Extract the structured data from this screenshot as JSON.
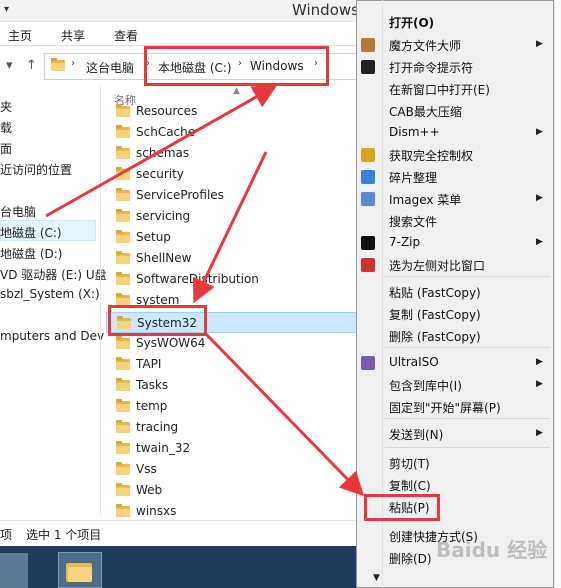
{
  "window": {
    "title": "Windows"
  },
  "ribbon": {
    "tabs": [
      "主页",
      "共享",
      "查看"
    ]
  },
  "address": {
    "crumbs": [
      "这台电脑",
      "本地磁盘 (C:)",
      "Windows"
    ]
  },
  "nav": {
    "items": [
      "夹",
      "载",
      "面",
      "近访问的位置",
      "台电脑",
      "地磁盘 (C:)",
      "地磁盘 (D:)",
      "VD 驱动器 (E:) U盘",
      "sbzl_System (X:)",
      "mputers and Dev"
    ]
  },
  "filelist": {
    "column_header": "名称",
    "folders": [
      "Resources",
      "SchCache",
      "schemas",
      "security",
      "ServiceProfiles",
      "servicing",
      "Setup",
      "ShellNew",
      "SoftwareDistribution",
      "system",
      "System32",
      "SysWOW64",
      "TAPI",
      "Tasks",
      "temp",
      "tracing",
      "twain_32",
      "Vss",
      "Web",
      "winsxs"
    ],
    "selected": "System32"
  },
  "status": {
    "count": "项",
    "selection": "选中 1 个项目"
  },
  "context_menu": {
    "items": [
      {
        "label": "打开(O)",
        "bold": true
      },
      {
        "label": "魔方文件大师",
        "submenu": true,
        "icon": "mofang-icon"
      },
      {
        "label": "打开命令提示符",
        "icon": "cmd-icon"
      },
      {
        "label": "在新窗口中打开(E)"
      },
      {
        "label": "CAB最大压缩"
      },
      {
        "label": "Dism++",
        "submenu": true
      },
      {
        "label": "获取完全控制权",
        "icon": "shield-icon"
      },
      {
        "label": "碎片整理",
        "icon": "defrag-icon"
      },
      {
        "label": "Imagex 菜单",
        "submenu": true,
        "icon": "imagex-icon"
      },
      {
        "label": "搜索文件"
      },
      {
        "label": "7-Zip",
        "submenu": true,
        "icon": "7zip-icon"
      },
      {
        "label": "选为左侧对比窗口",
        "icon": "compare-icon"
      },
      {
        "label": "粘贴 (FastCopy)"
      },
      {
        "label": "复制 (FastCopy)"
      },
      {
        "label": "删除 (FastCopy)"
      },
      {
        "label": "UltraISO",
        "submenu": true,
        "icon": "ultraiso-icon"
      },
      {
        "label": "包含到库中(I)",
        "submenu": true
      },
      {
        "label": "固定到\"开始\"屏幕(P)"
      },
      {
        "label": "发送到(N)",
        "submenu": true
      },
      {
        "label": "剪切(T)"
      },
      {
        "label": "复制(C)"
      },
      {
        "label": "粘贴(P)"
      },
      {
        "label": "创建快捷方式(S)"
      },
      {
        "label": "删除(D)"
      }
    ]
  },
  "watermark": "Baidu 经验",
  "colors": {
    "highlight": "#e8383d",
    "selection": "#cce8ff",
    "taskbar": "#1e3c5c"
  }
}
